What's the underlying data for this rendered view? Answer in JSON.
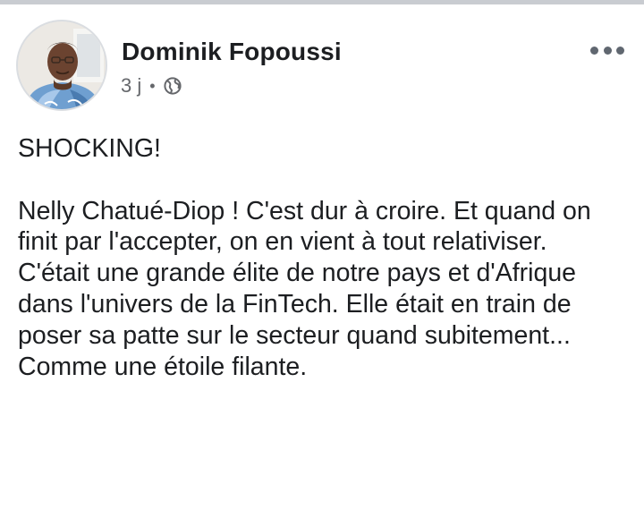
{
  "post": {
    "author": {
      "name": "Dominik Fopoussi",
      "avatar_icon": "profile-photo"
    },
    "meta": {
      "time": "3 j",
      "separator": "•",
      "audience_icon": "globe-icon"
    },
    "menu_icon": "more-options-icon",
    "body": {
      "headline": "SHOCKING!",
      "paragraph_1": "Nelly Chatué-Diop ! C'est dur à croire. Et quand on finit par l'accepter, on en vient à tout relativiser.",
      "paragraph_2": "C'était une grande élite de notre pays et d'Afrique dans l'univers de la FinTech. Elle était en train de poser sa patte sur le secteur quand subitement... Comme une étoile filante."
    }
  },
  "colors": {
    "text_primary": "#1c1e21",
    "text_secondary": "#65676b",
    "divider": "#c9ccd1"
  }
}
